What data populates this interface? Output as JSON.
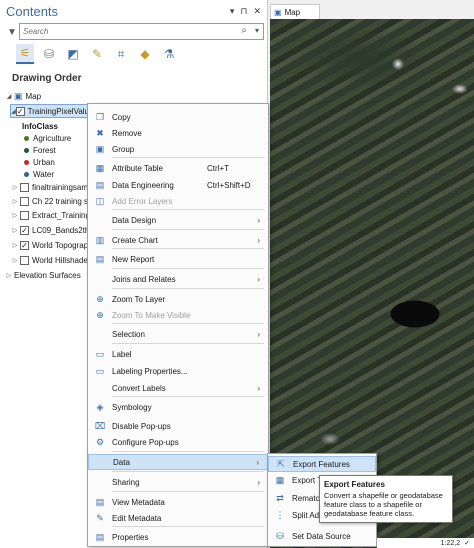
{
  "contents": {
    "title": "Contents",
    "search_placeholder": "Search",
    "section_title": "Drawing Order",
    "map_label": "Map",
    "selected_layer": "TrainingPixelValu",
    "legend_field": "InfoClass",
    "legend": [
      {
        "label": "Agriculture",
        "color": "#4a7a1f"
      },
      {
        "label": "Forest",
        "color": "#1e5b2a"
      },
      {
        "label": "Urban",
        "color": "#c8282d"
      },
      {
        "label": "Water",
        "color": "#2b5fa8"
      }
    ],
    "layers": [
      {
        "label": "finaltrainingsam",
        "checked": false
      },
      {
        "label": "Ch 22 training sa",
        "checked": false
      },
      {
        "label": "Extract_Training",
        "checked": false
      },
      {
        "label": "LC09_Bands2thr",
        "checked": true
      },
      {
        "label": "World Topograp",
        "checked": true
      },
      {
        "label": "World Hillshade",
        "checked": false
      }
    ],
    "elevation": "Elevation Surfaces"
  },
  "map_tab": "Map",
  "menu": [
    {
      "label": "Copy",
      "icon": "copy-icon",
      "glyph": "❐"
    },
    {
      "label": "Remove",
      "icon": "remove-icon",
      "glyph": "✖"
    },
    {
      "label": "Group",
      "icon": "group-icon",
      "glyph": "▣"
    },
    {
      "label": "Attribute Table",
      "icon": "table-icon",
      "glyph": "▦",
      "shortcut": "Ctrl+T"
    },
    {
      "label": "Data Engineering",
      "icon": "data-engineering-icon",
      "glyph": "▤",
      "shortcut": "Ctrl+Shift+D"
    },
    {
      "label": "Add Error Layers",
      "icon": "error-layers-icon",
      "glyph": "◫",
      "disabled": true
    },
    {
      "label": "Data Design",
      "arrow": true
    },
    {
      "label": "Create Chart",
      "icon": "chart-icon",
      "glyph": "▥",
      "arrow": true
    },
    {
      "label": "New Report",
      "icon": "report-icon",
      "glyph": "▤"
    },
    {
      "label": "Joins and Relates",
      "arrow": true
    },
    {
      "label": "Zoom To Layer",
      "icon": "zoom-layer-icon",
      "glyph": "⊕"
    },
    {
      "label": "Zoom To Make Visible",
      "icon": "zoom-visible-icon",
      "glyph": "⊕",
      "disabled": true
    },
    {
      "label": "Selection",
      "arrow": true
    },
    {
      "label": "Label",
      "icon": "label-icon",
      "glyph": "▭"
    },
    {
      "label": "Labeling Properties...",
      "icon": "labeling-icon",
      "glyph": "▭"
    },
    {
      "label": "Convert Labels",
      "arrow": true
    },
    {
      "label": "Symbology",
      "icon": "symbology-icon",
      "glyph": "◈"
    },
    {
      "label": "Disable Pop-ups",
      "icon": "popup-disable-icon",
      "glyph": "⌧"
    },
    {
      "label": "Configure Pop-ups",
      "icon": "popup-config-icon",
      "glyph": "⚙"
    },
    {
      "label": "Data",
      "arrow": true,
      "highlight": true
    },
    {
      "label": "Sharing",
      "arrow": true
    },
    {
      "label": "View Metadata",
      "icon": "metadata-icon",
      "glyph": "▤"
    },
    {
      "label": "Edit Metadata",
      "icon": "edit-metadata-icon",
      "glyph": "✎"
    },
    {
      "label": "Properties",
      "icon": "properties-icon",
      "glyph": "▤"
    }
  ],
  "submenu": [
    {
      "label": "Export Features",
      "glyph": "⇱"
    },
    {
      "label": "Export Tab",
      "glyph": "▦"
    },
    {
      "label": "Rematch",
      "glyph": "⇄"
    },
    {
      "label": "Split Addr",
      "glyph": "⋮"
    },
    {
      "label": "Set Data Source",
      "glyph": "⛁"
    }
  ],
  "tooltip": {
    "title": "Export Features",
    "body": "Convert a shapefile or geodatabase feature class to a shapefile or geodatabase feature class."
  },
  "status": {
    "scale": "1:22,2",
    "rot": "✓"
  }
}
